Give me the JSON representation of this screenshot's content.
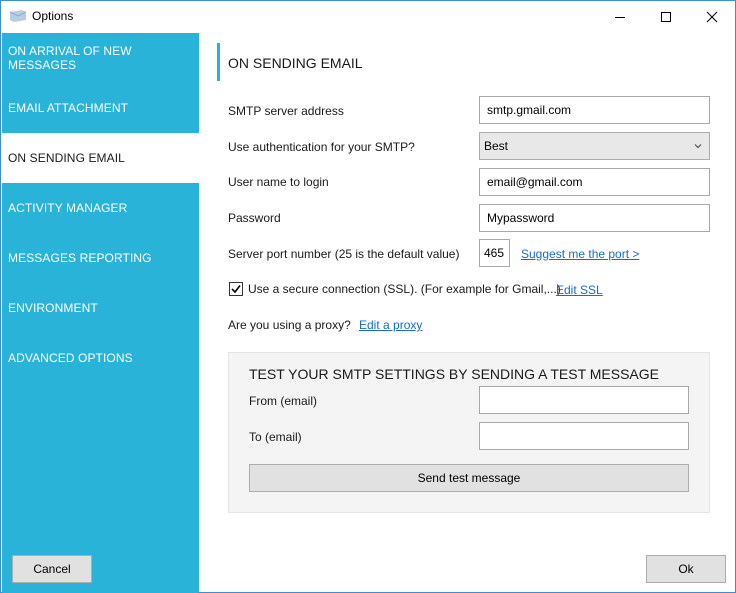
{
  "window": {
    "title": "Options",
    "accent_color": "#2ab3d9"
  },
  "sidebar": {
    "items": [
      {
        "label": "ON ARRIVAL OF NEW MESSAGES",
        "active": false
      },
      {
        "label": "EMAIL ATTACHMENT",
        "active": false
      },
      {
        "label": "ON SENDING EMAIL",
        "active": true
      },
      {
        "label": "ACTIVITY MANAGER",
        "active": false
      },
      {
        "label": "MESSAGES REPORTING",
        "active": false
      },
      {
        "label": "ENVIRONMENT",
        "active": false
      },
      {
        "label": "ADVANCED OPTIONS",
        "active": false
      }
    ],
    "cancel_label": "Cancel"
  },
  "main": {
    "section_title": "ON SENDING EMAIL",
    "smtp_server": {
      "label": "SMTP server address",
      "value": "smtp.gmail.com"
    },
    "authentication": {
      "label": "Use authentication for your SMTP?",
      "value": "Best"
    },
    "username": {
      "label": "User name to login",
      "value": "email@gmail.com"
    },
    "password": {
      "label": "Password",
      "value": "Mypassword"
    },
    "port": {
      "label": "Server port number (25 is the default value)",
      "value": "465",
      "suggest_link": "Suggest me the port >"
    },
    "ssl": {
      "label": "Use a secure connection (SSL). (For example for Gmail,...)",
      "checked": true,
      "edit_link": "Edit SSL"
    },
    "proxy": {
      "label": "Are you using a proxy?",
      "edit_link": "Edit a proxy"
    },
    "test": {
      "title": "TEST YOUR SMTP SETTINGS BY SENDING A TEST MESSAGE",
      "from_label": "From (email)",
      "from_value": "",
      "to_label": "To (email)",
      "to_value": "",
      "send_label": "Send test message"
    },
    "ok_label": "Ok"
  }
}
